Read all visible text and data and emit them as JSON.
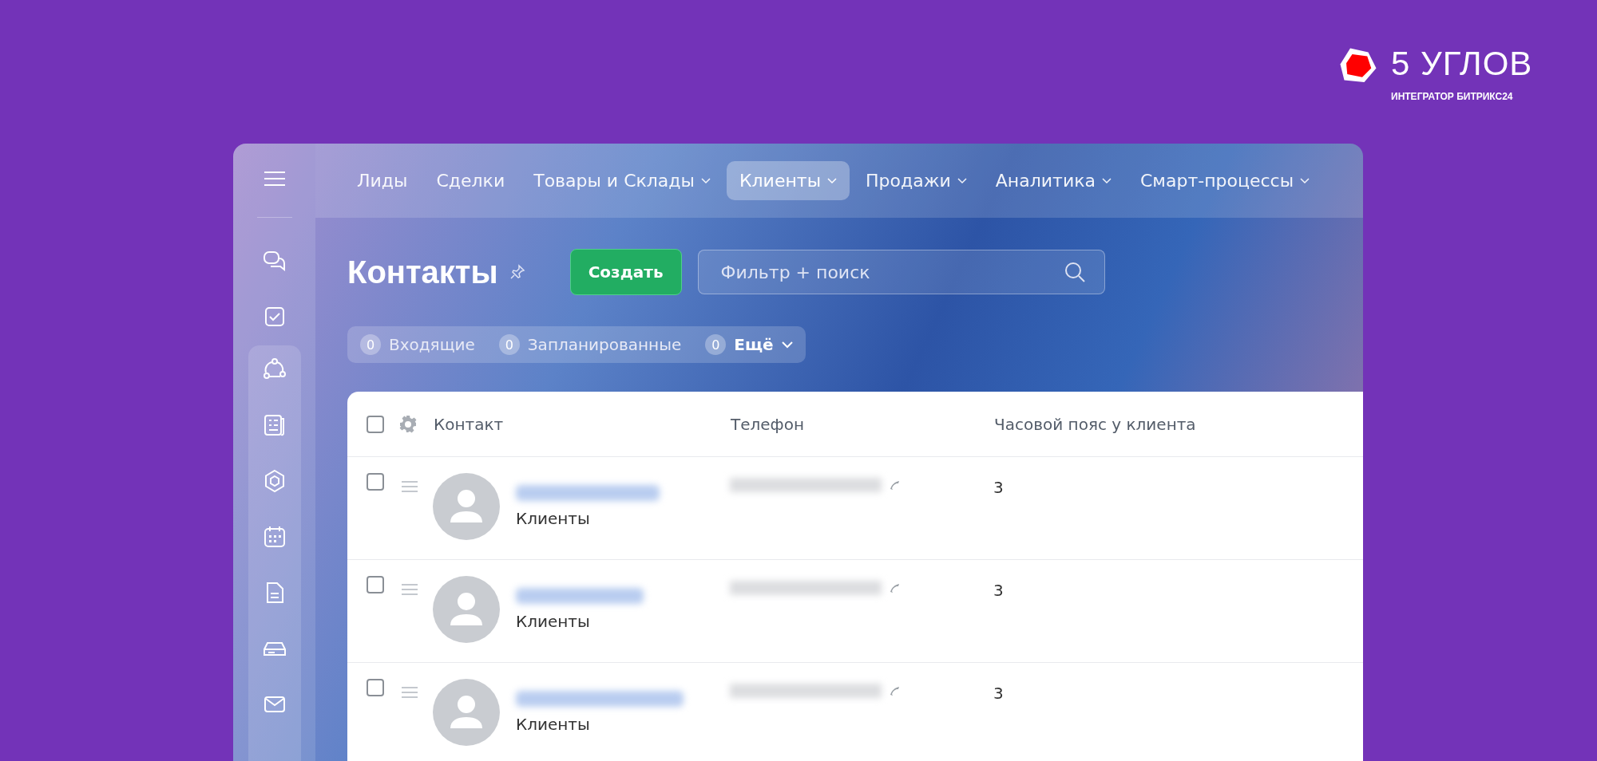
{
  "logo": {
    "title": "5 УГЛОВ",
    "subtitle": "ИНТЕГРАТОР БИТРИКС24"
  },
  "nav": [
    {
      "label": "Лиды",
      "selected": false,
      "dropdown": false
    },
    {
      "label": "Сделки",
      "selected": false,
      "dropdown": false
    },
    {
      "label": "Товары и Склады",
      "selected": false,
      "dropdown": true
    },
    {
      "label": "Клиенты",
      "selected": true,
      "dropdown": true
    },
    {
      "label": "Продажи",
      "selected": false,
      "dropdown": true
    },
    {
      "label": "Аналитика",
      "selected": false,
      "dropdown": true
    },
    {
      "label": "Смарт-процессы",
      "selected": false,
      "dropdown": true
    }
  ],
  "page_title": "Контакты",
  "create_button": "Создать",
  "search": {
    "placeholder": "Фильтр + поиск"
  },
  "counters": [
    {
      "count": "0",
      "label": "Входящие"
    },
    {
      "count": "0",
      "label": "Запланированные"
    },
    {
      "count": "0",
      "label": "Ещё"
    }
  ],
  "table": {
    "all_checked": false,
    "columns": [
      "Контакт",
      "Телефон",
      "Часовой пояс у клиента"
    ],
    "rows": [
      {
        "checked": false,
        "type": "Клиенты",
        "timezone": "3"
      },
      {
        "checked": false,
        "type": "Клиенты",
        "timezone": "3"
      },
      {
        "checked": false,
        "type": "Клиенты",
        "timezone": "3"
      }
    ]
  }
}
